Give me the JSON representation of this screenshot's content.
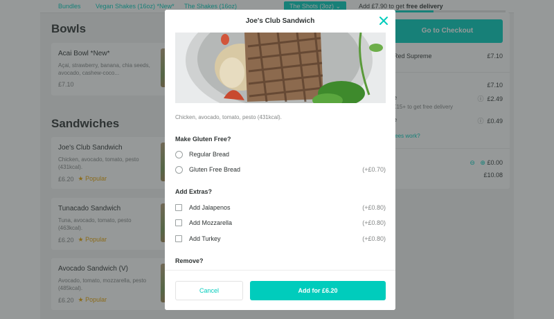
{
  "nav": {
    "tabs": [
      "Bundles",
      "Vegan Shakes (16oz) *New*",
      "The Shakes (16oz)",
      "The Shots (3oz)"
    ],
    "delivery_prefix": "Add £7.90 to get ",
    "delivery_bold": "free delivery",
    "delivery_progress": 0.47
  },
  "menu": {
    "bowls_title": "Bowls",
    "sandwiches_title": "Sandwiches",
    "bowls": [
      {
        "name": "Acai Bowl *New*",
        "desc": "Açai, strawberry, banana, chia seeds, avocado, cashew-coco...",
        "price": "£7.10"
      }
    ],
    "sandwiches": [
      {
        "name": "Joe's Club Sandwich",
        "desc": "Chicken, avocado, tomato, pesto (431kcal).",
        "price": "£6.20",
        "badge": "Popular"
      },
      {
        "name": "Tunacado Sandwich",
        "desc": "Tuna, avocado, tomato, pesto (463kcal).",
        "price": "£6.20",
        "badge": "Popular"
      },
      {
        "name": "Avocado Sandwich (V)",
        "desc": "Avocado, tomato, mozzarella, pesto (485kcal).",
        "price": "£6.20",
        "badge": "Popular"
      }
    ]
  },
  "basket": {
    "checkout_label": "Go to Checkout",
    "item_name": "Red Supreme",
    "item_price": "£7.10",
    "subtotal": "£7.10",
    "fee_label": "e",
    "fee_value": "£2.49",
    "fee_hint": "£15+ to get free delivery",
    "fee2_label": "e",
    "fee2_value": "£0.49",
    "fees_link": "fees work?",
    "tip_value": "£0.00",
    "total": "£10.08"
  },
  "modal": {
    "title": "Joe's Club Sandwich",
    "description": "Chicken, avocado, tomato, pesto (431kcal).",
    "gluten_title": "Make Gluten Free?",
    "gluten_options": [
      {
        "label": "Regular Bread",
        "price": ""
      },
      {
        "label": "Gluten Free Bread",
        "price": "(+£0.70)"
      }
    ],
    "extras_title": "Add Extras?",
    "extras": [
      {
        "label": "Add Jalapenos",
        "price": "(+£0.80)"
      },
      {
        "label": "Add Mozzarella",
        "price": "(+£0.80)"
      },
      {
        "label": "Add Turkey",
        "price": "(+£0.80)"
      }
    ],
    "remove_title": "Remove?",
    "cancel_label": "Cancel",
    "add_label": "Add for £6.20"
  }
}
